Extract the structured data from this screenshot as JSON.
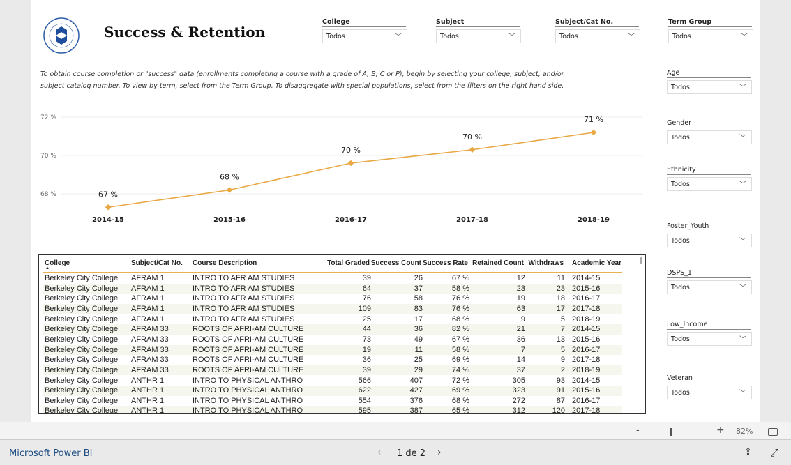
{
  "header": {
    "title": "Success & Retention",
    "logo_text": "PERALTA COMMUNITY COLLEGE DISTRICT",
    "description": "To obtain course completion or \"success\" data (enrollments completing a course with a grade of A, B, C or P), begin by selecting your college, subject, and/or subject catalog number. To view by term, select from the Term Group. To disaggregate with special populations, select from the filters on the right hand side."
  },
  "top_filters": [
    {
      "label": "College",
      "value": "Todos"
    },
    {
      "label": "Subject",
      "value": "Todos"
    },
    {
      "label": "Subject/Cat No.",
      "value": "Todos"
    },
    {
      "label": "Term Group",
      "value": "Todos"
    }
  ],
  "side_filters": [
    {
      "label": "Age",
      "value": "Todos"
    },
    {
      "label": "Gender",
      "value": "Todos"
    },
    {
      "label": "Ethnicity",
      "value": "Todos"
    },
    {
      "label": "Foster_Youth",
      "value": "Todos"
    },
    {
      "label": "DSPS_1",
      "value": "Todos"
    },
    {
      "label": "Low_Income",
      "value": "Todos"
    },
    {
      "label": "Veteran",
      "value": "Todos"
    }
  ],
  "chart_data": {
    "type": "line",
    "categories": [
      "2014-15",
      "2015-16",
      "2016-17",
      "2017-18",
      "2018-19"
    ],
    "values": [
      67.3,
      68.2,
      69.6,
      70.3,
      71.2
    ],
    "data_labels": [
      "67 %",
      "68 %",
      "70 %",
      "70 %",
      "71 %"
    ],
    "yticks": [
      "68 %",
      "70 %",
      "72 %"
    ],
    "ytick_values": [
      68,
      70,
      72
    ],
    "ylim": [
      67,
      72.2
    ],
    "color": "#e8a844",
    "grid": true
  },
  "table": {
    "columns": [
      "College",
      "Subject/Cat No.",
      "Course Description",
      "Total Graded",
      "Success Count",
      "Success Rate",
      "Retained Count",
      "Withdraws",
      "Academic Year"
    ],
    "rows": [
      [
        "Berkeley City College",
        "AFRAM 1",
        "INTRO TO AFR AM STUDIES",
        "39",
        "26",
        "67 %",
        "12",
        "11",
        "2014-15"
      ],
      [
        "Berkeley City College",
        "AFRAM 1",
        "INTRO TO AFR AM STUDIES",
        "64",
        "37",
        "58 %",
        "23",
        "23",
        "2015-16"
      ],
      [
        "Berkeley City College",
        "AFRAM 1",
        "INTRO TO AFR AM STUDIES",
        "76",
        "58",
        "76 %",
        "19",
        "18",
        "2016-17"
      ],
      [
        "Berkeley City College",
        "AFRAM 1",
        "INTRO TO AFR AM STUDIES",
        "109",
        "83",
        "76 %",
        "63",
        "17",
        "2017-18"
      ],
      [
        "Berkeley City College",
        "AFRAM 1",
        "INTRO TO AFR AM STUDIES",
        "25",
        "17",
        "68 %",
        "9",
        "5",
        "2018-19"
      ],
      [
        "Berkeley City College",
        "AFRAM 33",
        "ROOTS OF AFRI-AM CULTURE",
        "44",
        "36",
        "82 %",
        "21",
        "7",
        "2014-15"
      ],
      [
        "Berkeley City College",
        "AFRAM 33",
        "ROOTS OF AFRI-AM CULTURE",
        "73",
        "49",
        "67 %",
        "36",
        "13",
        "2015-16"
      ],
      [
        "Berkeley City College",
        "AFRAM 33",
        "ROOTS OF AFRI-AM CULTURE",
        "19",
        "11",
        "58 %",
        "7",
        "5",
        "2016-17"
      ],
      [
        "Berkeley City College",
        "AFRAM 33",
        "ROOTS OF AFRI-AM CULTURE",
        "36",
        "25",
        "69 %",
        "14",
        "9",
        "2017-18"
      ],
      [
        "Berkeley City College",
        "AFRAM 33",
        "ROOTS OF AFRI-AM CULTURE",
        "39",
        "29",
        "74 %",
        "37",
        "2",
        "2018-19"
      ],
      [
        "Berkeley City College",
        "ANTHR 1",
        "INTRO TO PHYSICAL ANTHRO",
        "566",
        "407",
        "72 %",
        "305",
        "93",
        "2014-15"
      ],
      [
        "Berkeley City College",
        "ANTHR 1",
        "INTRO TO PHYSICAL ANTHRO",
        "622",
        "427",
        "69 %",
        "323",
        "91",
        "2015-16"
      ],
      [
        "Berkeley City College",
        "ANTHR 1",
        "INTRO TO PHYSICAL ANTHRO",
        "554",
        "376",
        "68 %",
        "272",
        "87",
        "2016-17"
      ],
      [
        "Berkeley City College",
        "ANTHR 1",
        "INTRO TO PHYSICAL ANTHRO",
        "595",
        "387",
        "65 %",
        "312",
        "120",
        "2017-18"
      ]
    ]
  },
  "zoom": {
    "minus": "-",
    "plus": "+",
    "level": "82%"
  },
  "footer": {
    "brand": "Microsoft Power BI",
    "page_indicator": "1 de 2"
  }
}
